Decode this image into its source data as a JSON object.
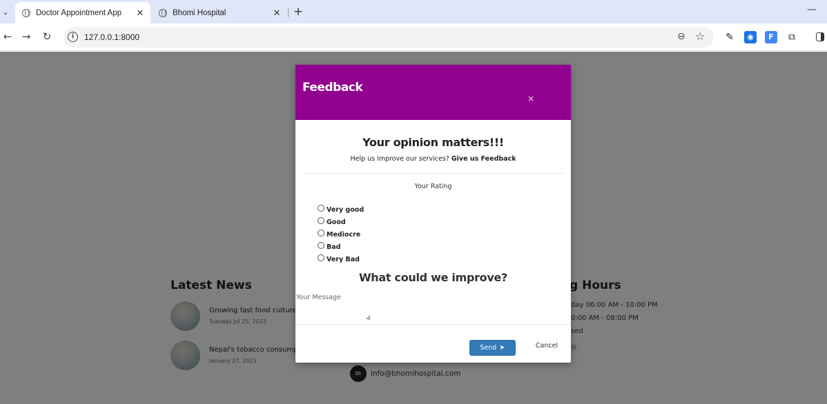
{
  "browser": {
    "tabs": [
      {
        "title": "Doctor Appointment App",
        "active": true
      },
      {
        "title": "Bhomi Hospital",
        "active": false
      }
    ],
    "url": "127.0.0.1:8000"
  },
  "background_page": {
    "latest_news_title": "Latest News",
    "news": [
      {
        "title": "Growing fast food culture",
        "date": "Tuesday Jul 25, 2023"
      },
      {
        "title": "Nepal's tobacco consump",
        "date": "January 27, 2023"
      }
    ],
    "hours_title": "g Hours",
    "hours": [
      {
        "text": "day    06:00 AM - 10:00 PM"
      },
      {
        "text": "0:00 AM - 08:00 PM"
      },
      {
        "text": "sed"
      }
    ],
    "email": "info@bhomihospital.com"
  },
  "modal": {
    "title": "Feedback",
    "close_symbol": "×",
    "headline": "Your opinion matters!!!",
    "subline_prefix": "Help us improve our services?",
    "subline_bold": "Give us Feedback",
    "rating_label": "Your Rating",
    "rating_options": [
      "Very good",
      "Good",
      "Mediocre",
      "Bad",
      "Very Bad"
    ],
    "improve_heading": "What could we improve?",
    "message_placeholder": "Your Message",
    "message_value": "",
    "send_label": "Send",
    "cancel_label": "Cancel",
    "header_color": "#91008f",
    "send_color": "#337ab7"
  }
}
